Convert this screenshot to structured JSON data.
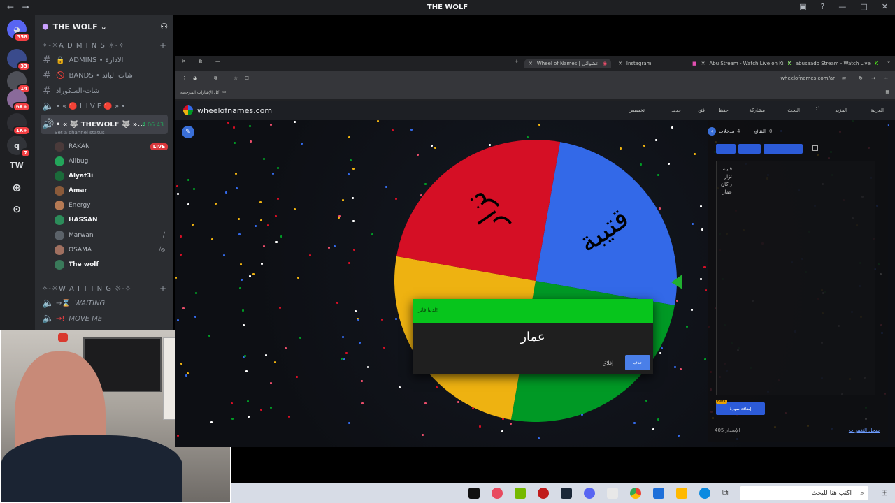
{
  "window": {
    "title": "THE WOLF"
  },
  "servers": [
    {
      "initials": "",
      "badge": "358"
    },
    {
      "initials": "",
      "badge": "33"
    },
    {
      "initials": "",
      "badge": "14"
    },
    {
      "initials": "",
      "badge": "6K+"
    },
    {
      "initials": "",
      "badge": "1K+"
    },
    {
      "initials": "q",
      "badge": "7"
    },
    {
      "initials": "TW",
      "badge": ""
    }
  ],
  "guild": {
    "name": "THE WOLF"
  },
  "categories": {
    "admins": "✧-☼A D M I N S ☼-✧",
    "waiting": "✧-☼W A I T I N G ☼-✧"
  },
  "channels": {
    "admins": "ADMINS • الادارة",
    "bands": "BANDS • شات الباند",
    "chat": "شات-السكوراد",
    "live": "• « 🔴 L I V E 🔴 » •",
    "thewolf": "• « 🐺 THEWOLF 🐺 »...",
    "thewolf_time": "4:06:43",
    "thewolf_status": "Set a channel status",
    "waiting": "WAITING",
    "moveme": "MOVE ME"
  },
  "voice_users": [
    {
      "name": "RAKAN",
      "bold": false,
      "live": "LIVE"
    },
    {
      "name": "Alibug",
      "bold": false,
      "live": ""
    },
    {
      "name": "Alyaf3i",
      "bold": true,
      "live": ""
    },
    {
      "name": "Amar",
      "bold": true,
      "live": ""
    },
    {
      "name": "Energy",
      "bold": false,
      "live": ""
    },
    {
      "name": "HASSAN",
      "bold": true,
      "live": ""
    },
    {
      "name": "Marwan",
      "bold": false,
      "live": ""
    },
    {
      "name": "OSAMA",
      "bold": false,
      "live": ""
    },
    {
      "name": "The wolf",
      "bold": true,
      "live": ""
    }
  ],
  "browser": {
    "tabs": [
      "Wheel of Names | عشوائي",
      "Instagram",
      "Abu Stream - Watch Live on Ki",
      "abusaado Stream - Watch Live"
    ],
    "url": "wheelofnames.com/ar",
    "bookmarks_label": "كل الإشارات المرجعية"
  },
  "won": {
    "logo": "wheelofnames.com",
    "menu": [
      "العربية",
      "المزيد",
      "",
      "البحث",
      "مشاركة",
      "حفظ",
      "فتح",
      "جديد",
      "تخصيص"
    ],
    "entries_tab": "مدخلات",
    "entries_count": "4",
    "results_tab": "النتائج",
    "results_count": "0",
    "entries": [
      "قتيبه",
      "نزار",
      "راكان",
      "عمار"
    ],
    "version_label": "الإصدار 405",
    "changelog": "سجل التغييرات",
    "beta": "Beta",
    "add_image": "إضافة صورة"
  },
  "wheel": {
    "slices": [
      {
        "label": "قتيبة",
        "color": "#3369e8"
      },
      {
        "label": "عمار",
        "color": "#009925"
      },
      {
        "label": "راكان",
        "color": "#eeb211"
      },
      {
        "label": "نزار",
        "color": "#d50f25"
      }
    ]
  },
  "dialog": {
    "header": "لدينا فائز!",
    "winner": "عمار",
    "close": "إغلاق",
    "remove": "حذف"
  },
  "taskbar": {
    "search_placeholder": "اكتب هنا للبحث"
  }
}
